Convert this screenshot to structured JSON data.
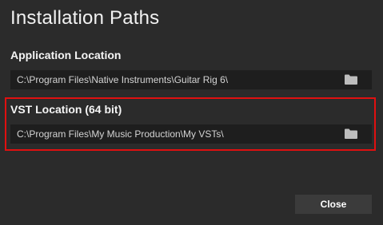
{
  "dialog": {
    "title": "Installation Paths",
    "close_label": "Close"
  },
  "application_location": {
    "label": "Application Location",
    "path": "C:\\Program Files\\Native Instruments\\Guitar Rig 6\\",
    "browse_icon": "folder-icon"
  },
  "vst_location": {
    "label": "VST Location (64 bit)",
    "path": "C:\\Program Files\\My Music Production\\My VSTs\\",
    "browse_icon": "folder-icon"
  },
  "colors": {
    "background": "#2b2b2b",
    "field_background": "#1e1e1e",
    "highlight_border": "#e01010",
    "button_background": "#3b3b3b",
    "icon": "#bdbdbd"
  }
}
